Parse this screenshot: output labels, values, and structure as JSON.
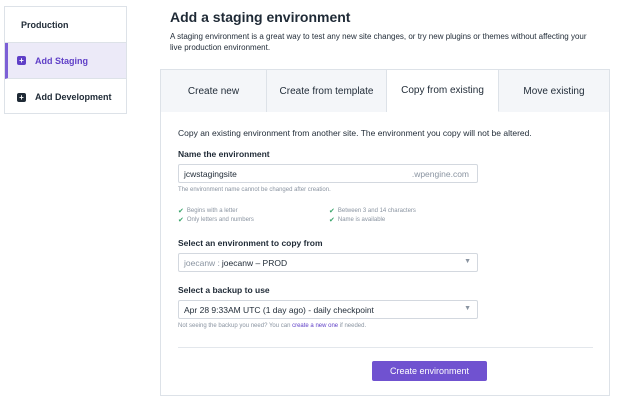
{
  "sidebar": {
    "items": [
      {
        "label": "Production"
      },
      {
        "label": "Add Staging"
      },
      {
        "label": "Add Development"
      }
    ],
    "icon": "plus-square-icon",
    "accent_color": "#5f3fc7"
  },
  "header": {
    "title": "Add a staging environment",
    "description": "A staging environment is a great way to test any new site changes, or try new plugins or themes without affecting your live production environment."
  },
  "tabs": [
    {
      "label": "Create new"
    },
    {
      "label": "Create from template"
    },
    {
      "label": "Copy from existing",
      "active": true
    },
    {
      "label": "Move existing"
    }
  ],
  "form": {
    "intro": "Copy an existing environment from another site. The environment you copy will not be altered.",
    "name_label": "Name the environment",
    "name_value": "jcwstagingsite",
    "name_suffix": ".wpengine.com",
    "name_hint": "The environment name cannot be changed after creation.",
    "rules": [
      "Begins with a letter",
      "Only letters and numbers",
      "Between 3 and 14 characters",
      "Name is available"
    ],
    "copy_label": "Select an environment to copy from",
    "copy_prefix": "joecanw :",
    "copy_value": "joecanw – PROD",
    "backup_label": "Select a backup to use",
    "backup_value": "Apr 28 9:33AM UTC (1 day ago) - daily checkpoint",
    "backup_hint_pre": "Not seeing the backup you need? You can ",
    "backup_hint_link": "create a new one",
    "backup_hint_post": " if needed.",
    "submit_label": "Create environment",
    "submit_color": "#7052d0"
  }
}
